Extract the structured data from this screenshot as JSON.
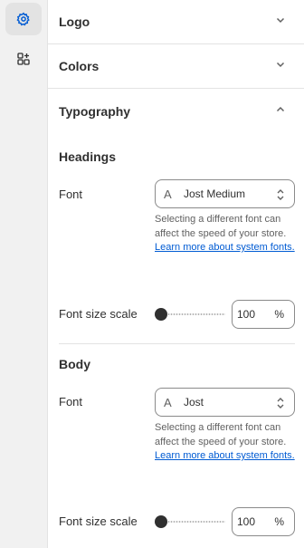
{
  "sidebar": {
    "items": [
      {
        "icon": "gear-icon",
        "active": true
      },
      {
        "icon": "add-section-icon",
        "active": false
      }
    ]
  },
  "sections": {
    "logo": {
      "title": "Logo"
    },
    "colors": {
      "title": "Colors"
    },
    "typography": {
      "title": "Typography"
    }
  },
  "typography": {
    "headings": {
      "title": "Headings",
      "font_label": "Font",
      "font_value": "Jost Medium",
      "help_text": "Selecting a different font can affect the speed of your store.",
      "help_link": "Learn more about system fonts.",
      "size_label": "Font size scale",
      "size_value": "100",
      "size_unit": "%"
    },
    "body": {
      "title": "Body",
      "font_label": "Font",
      "font_value": "Jost",
      "help_text": "Selecting a different font can affect the speed of your store.",
      "help_link": "Learn more about system fonts.",
      "size_label": "Font size scale",
      "size_value": "100",
      "size_unit": "%"
    }
  },
  "glyphs": {
    "font_picker": "A"
  },
  "colors": {
    "link": "#005bd3",
    "active_rail_bg": "#e3e3e3",
    "icon_active": "#005bd3"
  }
}
